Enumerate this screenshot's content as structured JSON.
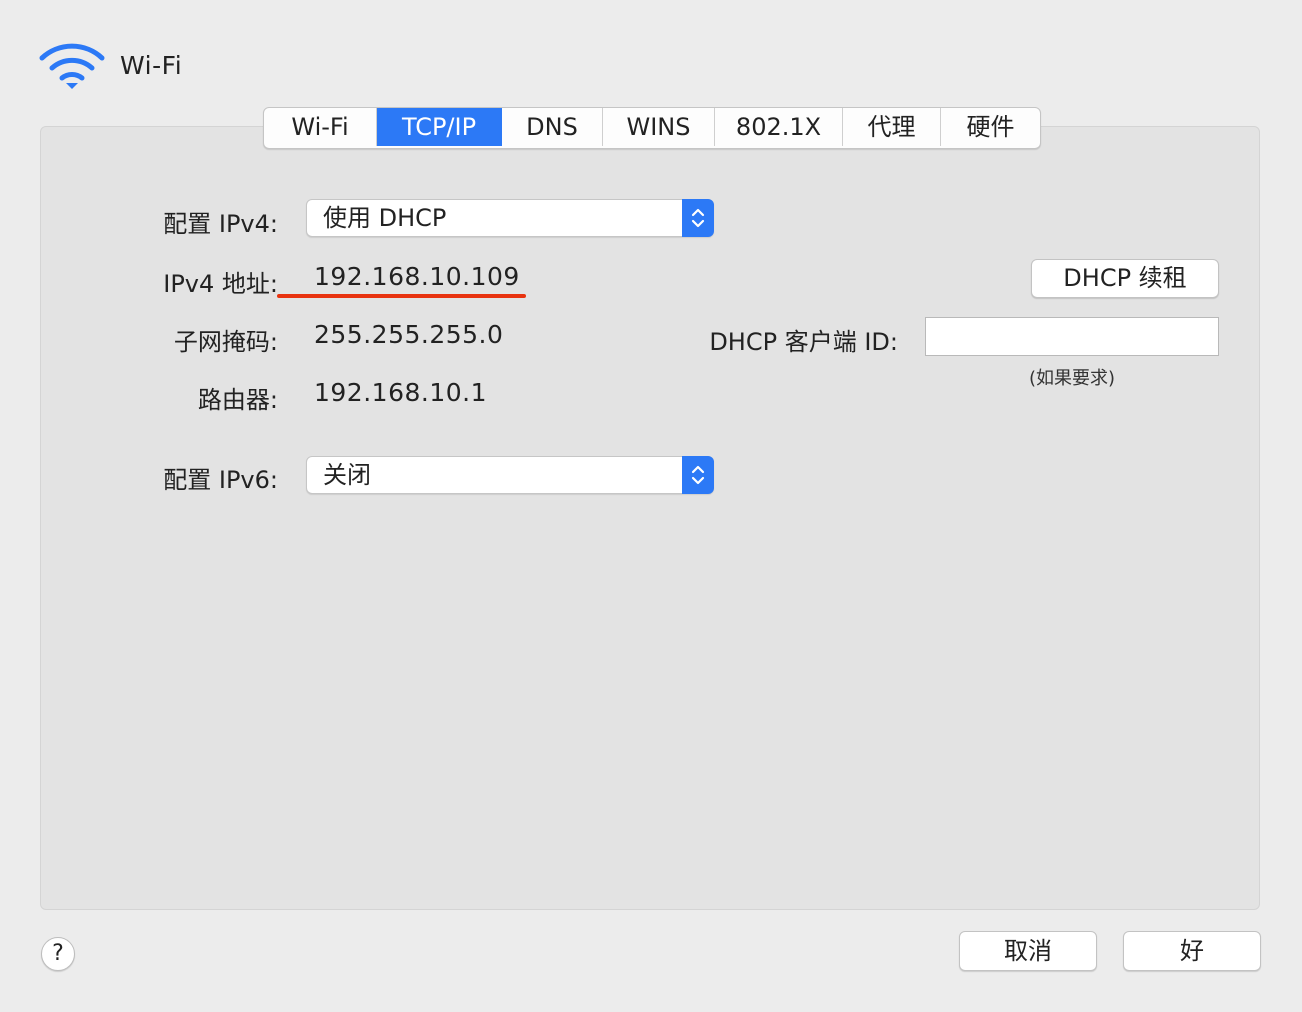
{
  "header": {
    "title": "Wi-Fi",
    "icon": "wifi-icon",
    "accent": "#2c79f6"
  },
  "tabs": [
    {
      "label": "Wi-Fi",
      "active": false
    },
    {
      "label": "TCP/IP",
      "active": true
    },
    {
      "label": "DNS",
      "active": false
    },
    {
      "label": "WINS",
      "active": false
    },
    {
      "label": "802.1X",
      "active": false
    },
    {
      "label": "代理",
      "active": false
    },
    {
      "label": "硬件",
      "active": false
    }
  ],
  "ipv4": {
    "config_label": "配置 IPv4:",
    "config_value": "使用 DHCP",
    "address_label": "IPv4 地址:",
    "address_value": "192.168.10.109",
    "subnet_label": "子网掩码:",
    "subnet_value": "255.255.255.0",
    "router_label": "路由器:",
    "router_value": "192.168.10.1"
  },
  "dhcp": {
    "renew_label": "DHCP 续租",
    "client_id_label": "DHCP 客户端 ID:",
    "client_id_value": "",
    "client_id_hint": "(如果要求)"
  },
  "ipv6": {
    "config_label": "配置 IPv6:",
    "config_value": "关闭"
  },
  "footer": {
    "help_label": "?",
    "cancel_label": "取消",
    "ok_label": "好"
  },
  "colors": {
    "highlight_underline": "#e8330f"
  }
}
